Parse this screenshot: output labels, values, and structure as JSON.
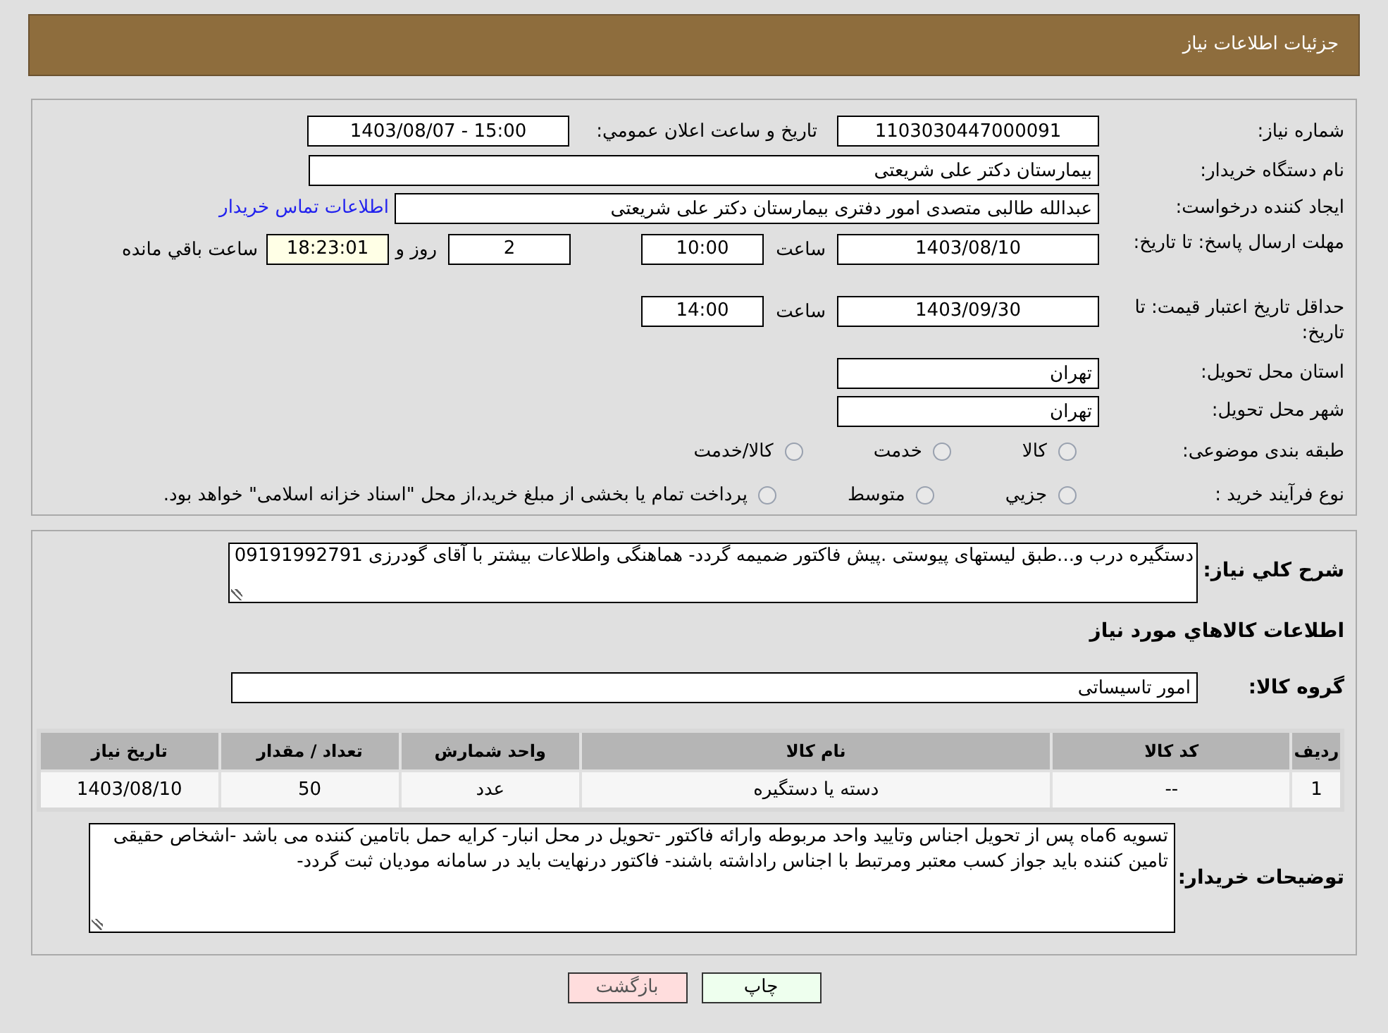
{
  "header": {
    "title": "جزئیات اطلاعات نیاز"
  },
  "details": {
    "need_number": {
      "label": "شماره نیاز:",
      "value": "1103030447000091"
    },
    "announce": {
      "label": "تاریخ و ساعت اعلان عمومي:",
      "value": "1403/08/07 - 15:00"
    },
    "buyer": {
      "label": "نام دستگاه خریدار:",
      "value": "بیمارستان دکتر علی شریعتی"
    },
    "creator": {
      "label": "ایجاد کننده درخواست:",
      "value": "عبدالله طالبی متصدی امور دفتری بیمارستان دکتر علی شریعتی",
      "link": "اطلاعات تماس خریدار"
    },
    "deadline": {
      "label": "مهلت ارسال پاسخ: تا تاریخ:",
      "date": "1403/08/10",
      "time_label": "ساعت",
      "time": "10:00",
      "days": "2",
      "days_label": "روز و",
      "remaining": "18:23:01",
      "remaining_label": "ساعت باقي مانده"
    },
    "validity": {
      "label": "حداقل تاریخ اعتبار قیمت: تا تاریخ:",
      "date": "1403/09/30",
      "time_label": "ساعت",
      "time": "14:00"
    },
    "province": {
      "label": "استان محل تحویل:",
      "value": "تهران"
    },
    "city": {
      "label": "شهر محل تحویل:",
      "value": "تهران"
    },
    "category": {
      "label": "طبقه بندی موضوعی:",
      "options": [
        {
          "label": "کالا",
          "selected": false
        },
        {
          "label": "خدمت",
          "selected": false
        },
        {
          "label": "کالا/خدمت",
          "selected": false
        }
      ]
    },
    "purchase_type": {
      "label": "نوع فرآیند خرید :",
      "options": [
        {
          "label": "جزيي",
          "selected": false
        },
        {
          "label": "متوسط",
          "selected": false
        },
        {
          "label": "پرداخت تمام یا بخشی از مبلغ خرید،از محل \"اسناد خزانه اسلامی\" خواهد بود.",
          "selected": false
        }
      ]
    }
  },
  "summary": {
    "label": "شرح کلي نیاز:",
    "value": "دستگیره درب و...طبق لیستهای پیوستی .پیش فاکتور ضمیمه گردد- هماهنگی واطلاعات بیشتر با آقای گودرزی 09191992791"
  },
  "goods_heading": "اطلاعات کالاهاي مورد نیاز",
  "goods_group": {
    "label": "گروه کالا:",
    "value": "امور تاسیساتی"
  },
  "table": {
    "columns": [
      "ردیف",
      "کد کالا",
      "نام کالا",
      "واحد شمارش",
      "تعداد / مقدار",
      "تاریخ نیاز"
    ],
    "rows": [
      [
        "1",
        "--",
        "دسته یا دستگیره",
        "عدد",
        "50",
        "1403/08/10"
      ]
    ]
  },
  "notes": {
    "label": "توضیحات خریدار:",
    "value": "تسویه 6ماه پس از تحویل اجناس وتایید واحد مربوطه وارائه فاکتور -تحویل در محل انبار- کرایه حمل باتامین کننده می باشد -اشخاص حقیقی تامین کننده باید جواز کسب معتبر ومرتبط با اجناس راداشته باشند- فاکتور درنهایت باید در سامانه مودیان ثبت گردد-"
  },
  "buttons": [
    {
      "label": "چاپ",
      "kind": "print"
    },
    {
      "label": "بازگشت",
      "kind": "back"
    }
  ]
}
